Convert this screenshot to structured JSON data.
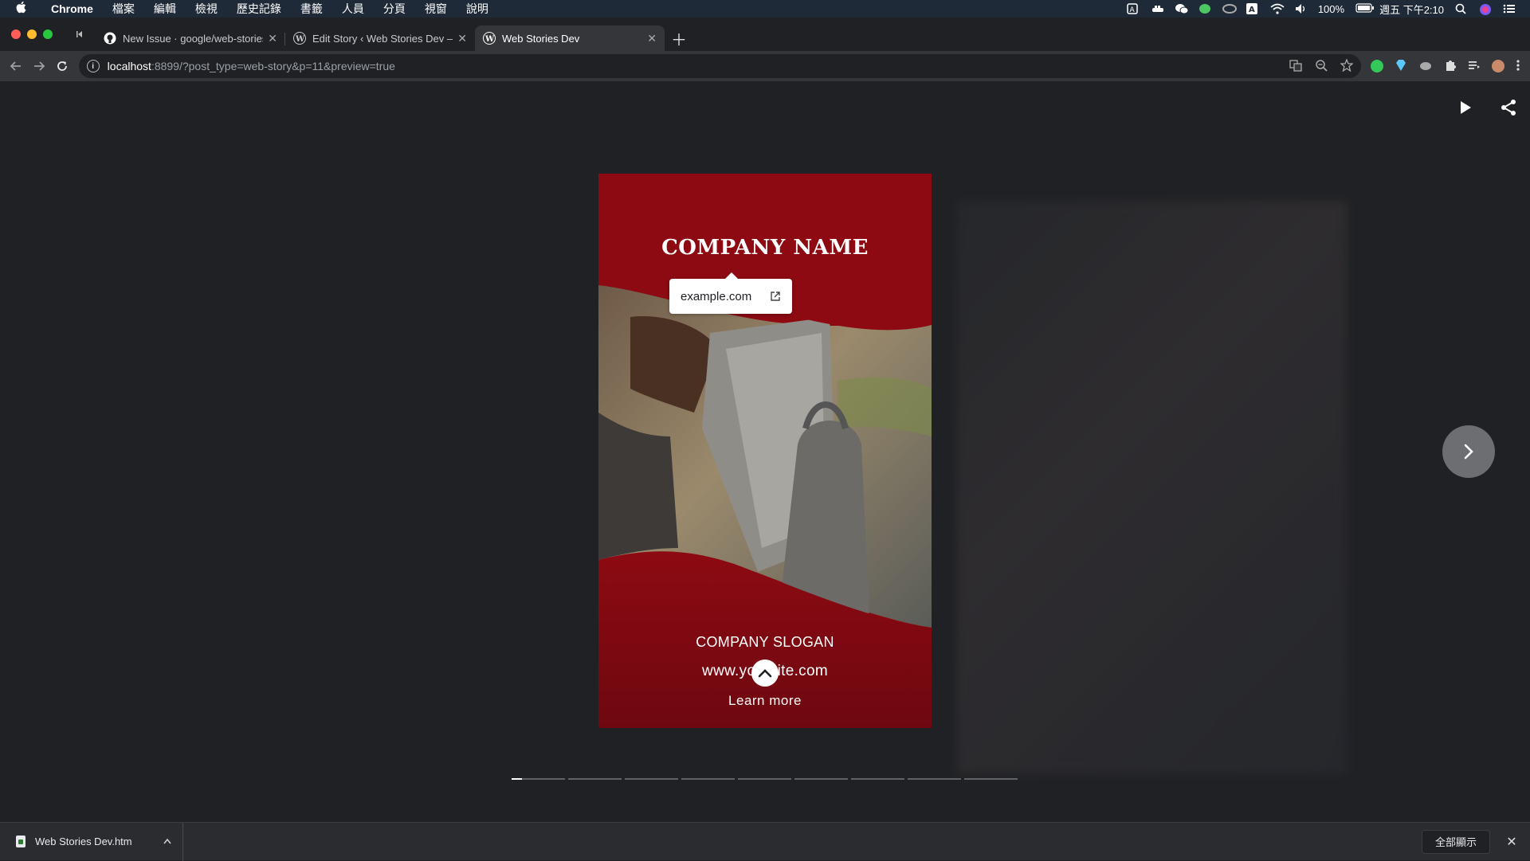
{
  "menubar": {
    "app": "Chrome",
    "items": [
      "檔案",
      "編輯",
      "檢視",
      "歷史記錄",
      "書籤",
      "人員",
      "分頁",
      "視窗",
      "說明"
    ],
    "battery": "100%",
    "clock": "週五 下午2:10"
  },
  "tabs": [
    {
      "title": "New Issue · google/web-stories",
      "icon": "github-icon"
    },
    {
      "title": "Edit Story ‹ Web Stories Dev — WordPress",
      "icon": "wordpress-icon"
    },
    {
      "title": "Web Stories Dev",
      "icon": "wordpress-icon",
      "active": true
    }
  ],
  "address": {
    "host": "localhost",
    "path": ":8899/?post_type=web-story&p=11&preview=true"
  },
  "story": {
    "company_name": "COMPANY NAME",
    "tooltip_link": "example.com",
    "slogan": "COMPANY SLOGAN",
    "website": "www.yoursite.com",
    "cta": "Learn more",
    "bg_color": "#8d0a12"
  },
  "progress": {
    "segments": 9,
    "current_index": 0,
    "current_fill": 0.2
  },
  "downloads": {
    "file_name": "Web Stories Dev.htm",
    "show_all": "全部顯示"
  }
}
